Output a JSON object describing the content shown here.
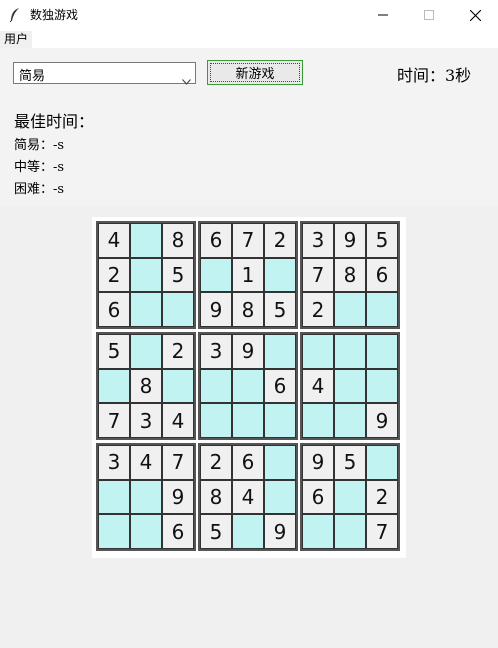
{
  "window": {
    "title": "数独游戏",
    "minimize": "—",
    "maximize": "☐",
    "close": "✕"
  },
  "menu": {
    "user": "用户"
  },
  "controls": {
    "difficulty_selected": "简易",
    "new_game_label": "新游戏",
    "time_label": "时间：3秒"
  },
  "best_times": {
    "title": "最佳时间：",
    "easy": "简易：-s",
    "medium": "中等：-s",
    "hard": "困难：-s"
  },
  "colors": {
    "empty_cell": "#c2f3f3",
    "given_cell": "#f0f0f0"
  },
  "board": [
    [
      "4",
      "",
      "8",
      "6",
      "7",
      "2",
      "3",
      "9",
      "5"
    ],
    [
      "2",
      "",
      "5",
      "",
      "1",
      "",
      "7",
      "8",
      "6"
    ],
    [
      "6",
      "",
      "",
      "9",
      "8",
      "5",
      "2",
      "",
      ""
    ],
    [
      "5",
      "",
      "2",
      "3",
      "9",
      "",
      "",
      "",
      ""
    ],
    [
      "",
      "8",
      "",
      "",
      "",
      "6",
      "4",
      "",
      ""
    ],
    [
      "7",
      "3",
      "4",
      "",
      "",
      "",
      "",
      "",
      "9"
    ],
    [
      "3",
      "4",
      "7",
      "2",
      "6",
      "",
      "9",
      "5",
      ""
    ],
    [
      "",
      "",
      "9",
      "8",
      "4",
      "",
      "6",
      "",
      "2"
    ],
    [
      "",
      "",
      "6",
      "5",
      "",
      "9",
      "",
      "",
      "7"
    ]
  ],
  "given_mask": [
    [
      1,
      0,
      1,
      1,
      1,
      1,
      1,
      1,
      1
    ],
    [
      1,
      0,
      1,
      0,
      1,
      0,
      1,
      1,
      1
    ],
    [
      1,
      0,
      0,
      1,
      1,
      1,
      1,
      0,
      0
    ],
    [
      1,
      0,
      1,
      1,
      1,
      0,
      0,
      0,
      0
    ],
    [
      0,
      1,
      0,
      0,
      0,
      1,
      1,
      0,
      0
    ],
    [
      1,
      1,
      1,
      0,
      0,
      0,
      0,
      0,
      1
    ],
    [
      1,
      1,
      1,
      1,
      1,
      0,
      1,
      1,
      0
    ],
    [
      0,
      0,
      1,
      1,
      1,
      0,
      1,
      0,
      1
    ],
    [
      0,
      0,
      1,
      1,
      0,
      1,
      0,
      0,
      1
    ]
  ]
}
